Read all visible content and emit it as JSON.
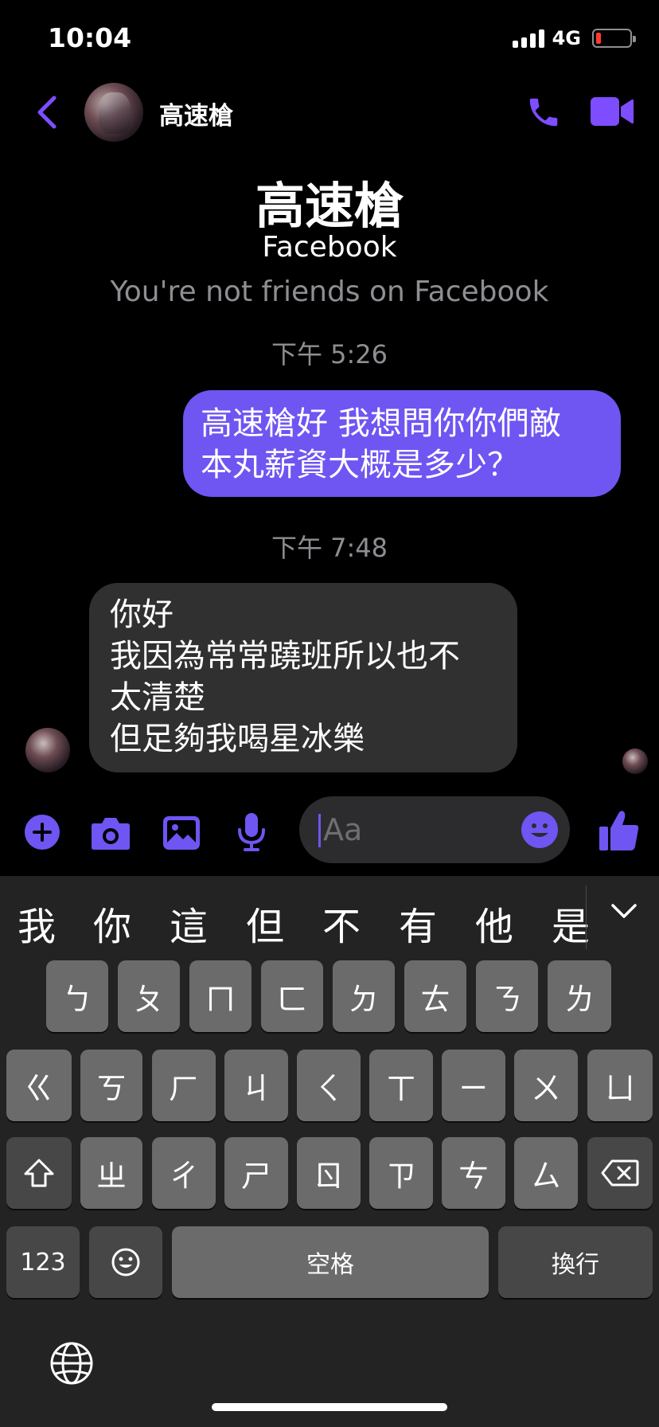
{
  "status": {
    "time": "10:04",
    "network": "4G"
  },
  "header": {
    "name": "高速槍"
  },
  "intro": {
    "name": "高速槍",
    "platform": "Facebook",
    "note": "You're not friends on Facebook"
  },
  "messages": [
    {
      "time": "下午 5:26",
      "direction": "outgoing",
      "lines": [
        "高速槍好 我想問你你們敵",
        "本丸薪資大概是多少？"
      ]
    },
    {
      "time": "下午 7:48",
      "direction": "incoming",
      "lines": [
        "你好",
        "我因為常常蹺班所以也不",
        "太清楚",
        "但足夠我喝星冰樂"
      ]
    }
  ],
  "composer": {
    "placeholder": "Aa"
  },
  "keyboard": {
    "candidates": [
      "我",
      "你",
      "這",
      "但",
      "不",
      "有",
      "他",
      "是"
    ],
    "row1": [
      "ㄅ",
      "ㄆ",
      "ㄇ",
      "ㄈ",
      "ㄉ",
      "ㄊ",
      "ㄋ",
      "ㄌ"
    ],
    "row2": [
      "ㄍ",
      "ㄎ",
      "ㄏ",
      "ㄐ",
      "ㄑ",
      "ㄒ",
      "ㄧ",
      "ㄨ",
      "ㄩ"
    ],
    "row3": [
      "ㄓ",
      "ㄔ",
      "ㄕ",
      "ㄖ",
      "ㄗ",
      "ㄘ",
      "ㄙ"
    ],
    "numbers_label": "123",
    "space_label": "空格",
    "return_label": "換行"
  },
  "icons": {
    "back": "chevron-left-icon",
    "call": "phone-icon",
    "video": "video-camera-icon",
    "plus": "plus-icon",
    "camera": "camera-icon",
    "gallery": "image-icon",
    "mic": "microphone-icon",
    "emoji": "emoji-icon",
    "like": "thumbs-up-icon",
    "globe": "globe-icon"
  },
  "colors": {
    "accent": "#6f55f2",
    "outgoing_bubble": "#6f55f2",
    "incoming_bubble": "#303030",
    "battery_low": "#ff3b30"
  }
}
